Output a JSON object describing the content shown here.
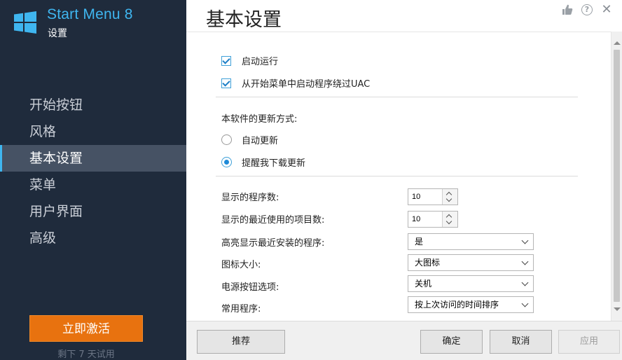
{
  "app": {
    "title": "Start Menu 8",
    "subtitle": "设置",
    "accent_color": "#3fb6f0",
    "sidebar_color": "#1f2b3c"
  },
  "sidebar": {
    "items": [
      {
        "label": "开始按钮",
        "active": false
      },
      {
        "label": "风格",
        "active": false
      },
      {
        "label": "基本设置",
        "active": true
      },
      {
        "label": "菜单",
        "active": false
      },
      {
        "label": "用户界面",
        "active": false
      },
      {
        "label": "高级",
        "active": false
      }
    ],
    "activate_button": "立即激活",
    "trial_text": "剩下 7 天试用"
  },
  "header": {
    "title": "基本设置",
    "icons": [
      "thumbs-up-icon",
      "help-icon",
      "close-icon"
    ],
    "help_glyph": "?",
    "close_glyph": "✕"
  },
  "options": {
    "checkboxes": [
      {
        "label": "启动运行",
        "checked": true
      },
      {
        "label": "从开始菜单中启动程序绕过UAC",
        "checked": true
      }
    ],
    "update_heading": "本软件的更新方式:",
    "update_radios": [
      {
        "label": "自动更新",
        "selected": false
      },
      {
        "label": "提醒我下载更新",
        "selected": true
      }
    ]
  },
  "fields": {
    "program_count": {
      "label": "显示的程序数:",
      "value": "10"
    },
    "recent_count": {
      "label": "显示的最近使用的项目数:",
      "value": "10"
    },
    "highlight_new": {
      "label": "高亮显示最近安装的程序:",
      "value": "是"
    },
    "icon_size": {
      "label": "图标大小:",
      "value": "大图标"
    },
    "power_button": {
      "label": "电源按钮选项:",
      "value": "关机"
    },
    "frequent_programs": {
      "label": "常用程序:",
      "value": "按上次访问的时间排序"
    }
  },
  "footer": {
    "recommend": "推荐",
    "ok": "确定",
    "cancel": "取消",
    "apply": "应用"
  }
}
